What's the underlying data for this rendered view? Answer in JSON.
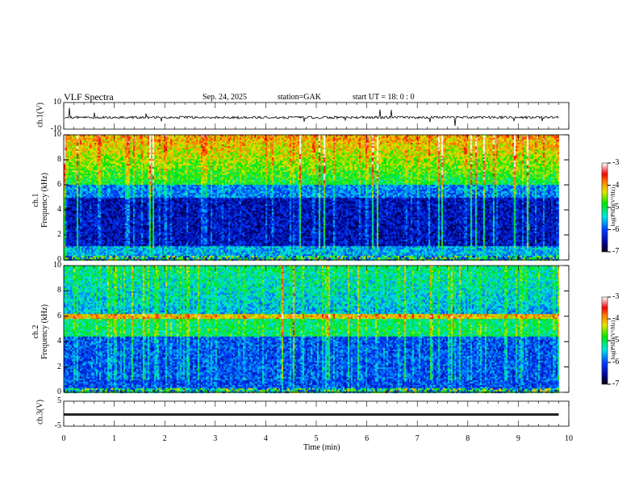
{
  "header": {
    "title": "VLF  Spectra",
    "date": "Sep. 24,  2025",
    "station": "station=GAK",
    "start": "start  UT  =    18: 0   : 0"
  },
  "chart_data": [
    {
      "type": "line",
      "name": "ch1",
      "ylabel": "ch.1(V)",
      "ylim": [
        -10,
        10
      ],
      "yticks": [
        "10",
        "-10"
      ],
      "baseline": 0,
      "noise": "spiky waveform around 0 V"
    },
    {
      "type": "heatmap",
      "name": "ch1-spectrogram",
      "ylabel": "ch.1\nFrequency  (kHz)",
      "ylabel_line1": "ch.1",
      "ylabel_line2": "Frequency  (kHz)",
      "ylim": [
        0,
        10
      ],
      "yticks": [
        "0",
        "2",
        "4",
        "6",
        "8",
        "10"
      ],
      "xlim": [
        0,
        9.8
      ],
      "colorbar": {
        "label": "log(PSD)(V²/Hz)",
        "range": [
          -7,
          -3
        ],
        "ticks": [
          "-3",
          "-4",
          "-5",
          "-6",
          "-7"
        ]
      }
    },
    {
      "type": "heatmap",
      "name": "ch2-spectrogram",
      "ylabel_line1": "ch.2",
      "ylabel_line2": "Frequency  (kHz)",
      "ylim": [
        0,
        10
      ],
      "yticks": [
        "0",
        "2",
        "4",
        "6",
        "8",
        "10"
      ],
      "xlim": [
        0,
        9.8
      ],
      "colorbar": {
        "label": "log(PSD)(V²/Hz)",
        "range": [
          -7,
          -3
        ],
        "ticks": [
          "-3",
          "-4",
          "-5",
          "-6",
          "-7"
        ]
      }
    },
    {
      "type": "line",
      "name": "ch3",
      "ylabel": "ch.3(V)",
      "ylim": [
        -5,
        5
      ],
      "yticks": [
        "5",
        "-5"
      ],
      "baseline": -0.5
    }
  ],
  "xaxis": {
    "label": "Time  (min)",
    "range": [
      0,
      10
    ],
    "ticks": [
      "0",
      "1",
      "2",
      "3",
      "4",
      "5",
      "6",
      "7",
      "8",
      "9",
      "10"
    ]
  }
}
